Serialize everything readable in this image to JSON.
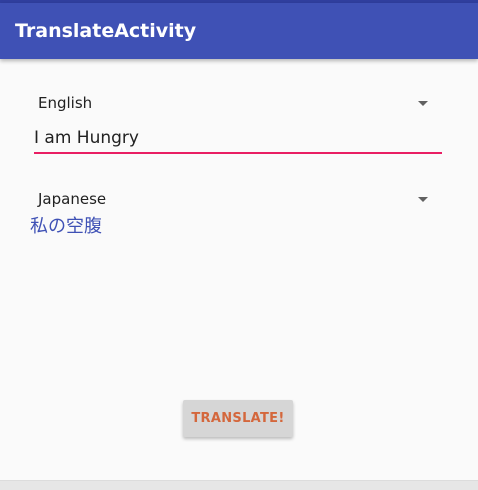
{
  "appbar": {
    "title": "TranslateActivity"
  },
  "source": {
    "language": "English",
    "input_value": "I am Hungry"
  },
  "target": {
    "language": "Japanese",
    "result_text": "私の空腹"
  },
  "actions": {
    "translate_label": "TRANSLATE!"
  },
  "colors": {
    "primary": "#3f51b5",
    "primary_dark": "#303f9f",
    "accent": "#e91e63",
    "button_text": "#d4673c"
  },
  "icons": {
    "dropdown": "caret-down-icon"
  }
}
